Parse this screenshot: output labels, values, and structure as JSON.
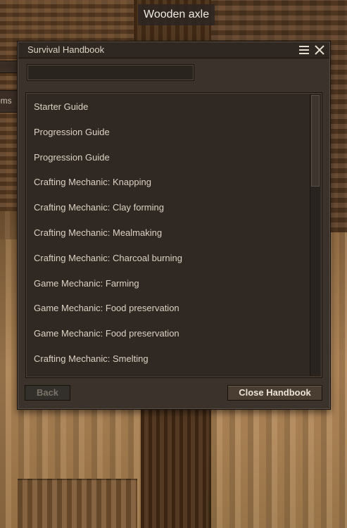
{
  "tooltip": "Wooden axle",
  "side_tab_label": "ems",
  "dialog": {
    "title": "Survival Handbook",
    "search_value": "",
    "items": [
      "Starter Guide",
      "Progression Guide",
      "Progression Guide",
      "Crafting Mechanic: Knapping",
      "Crafting Mechanic: Clay forming",
      "Crafting Mechanic: Mealmaking",
      "Crafting Mechanic: Charcoal burning",
      "Game Mechanic: Farming",
      "Game Mechanic: Food preservation",
      "Game Mechanic: Food preservation",
      "Crafting Mechanic: Smelting"
    ],
    "back_label": "Back",
    "close_label": "Close Handbook"
  },
  "icons": {
    "menu": "hamburger-menu-icon",
    "close": "close-icon"
  },
  "colors": {
    "dialog_bg": "#3a322b",
    "text": "#ddd3c4",
    "disabled_text": "#7a7268"
  }
}
